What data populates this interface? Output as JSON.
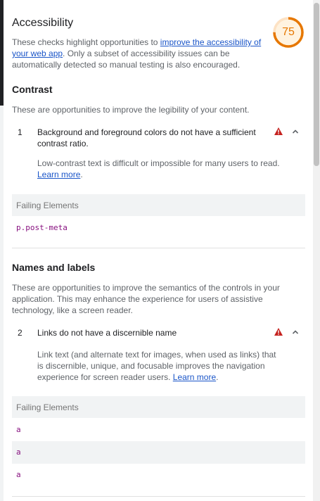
{
  "header": {
    "title": "Accessibility",
    "score": "75",
    "score_fraction": 0.75,
    "score_color": "#e67700",
    "intro_before": "These checks highlight opportunities to ",
    "intro_link": "improve the accessibility of your web app",
    "intro_after": ". Only a subset of accessibility issues can be automatically detected so manual testing is also encouraged."
  },
  "sections": [
    {
      "title": "Contrast",
      "description": "These are opportunities to improve the legibility of your content.",
      "audit": {
        "number": "1",
        "title": "Background and foreground colors do not have a sufficient contrast ratio.",
        "desc_before": "Low-contrast text is difficult or impossible for many users to read. ",
        "desc_link": "Learn more",
        "desc_after": ".",
        "failing_header": "Failing Elements",
        "elements": [
          "p.post-meta"
        ]
      }
    },
    {
      "title": "Names and labels",
      "description": "These are opportunities to improve the semantics of the controls in your application. This may enhance the experience for users of assistive technology, like a screen reader.",
      "audit": {
        "number": "2",
        "title": "Links do not have a discernible name",
        "desc_before": "Link text (and alternate text for images, when used as links) that is discernible, unique, and focusable improves the navigation experience for screen reader users. ",
        "desc_link": "Learn more",
        "desc_after": ".",
        "failing_header": "Failing Elements",
        "elements": [
          "a",
          "a",
          "a"
        ]
      }
    }
  ],
  "icons": {
    "warning": "warning-triangle-icon",
    "expand": "chevron-up-icon"
  },
  "colors": {
    "fail": "#c5221f",
    "link": "#1a55c8",
    "code": "#881280"
  }
}
